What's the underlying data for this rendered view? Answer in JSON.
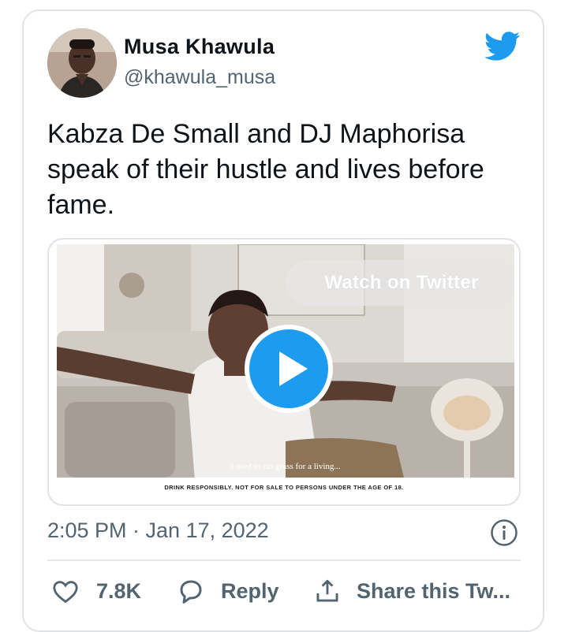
{
  "author": {
    "name": "Musa Khawula",
    "handle": "@khawula_musa",
    "avatar_icon": "profile-photo"
  },
  "brand_icon": "twitter-bird-icon",
  "brand_color": "#1d9bf0",
  "tweet": {
    "text": "Kabza De Small and DJ Maphorisa speak of their hustle and lives before fame."
  },
  "media": {
    "watch_label": "Watch on Twitter",
    "subtitle": "I used to cut grass for a living...",
    "disclaimer": "DRINK RESPONSIBLY. NOT FOR SALE TO PERSONS UNDER THE AGE OF 18.",
    "play_icon": "play-icon"
  },
  "meta": {
    "timestamp": "2:05 PM · Jan 17, 2022",
    "info_icon": "info-icon"
  },
  "actions": {
    "like_count": "7.8K",
    "reply_label": "Reply",
    "share_label": "Share this Tw..."
  }
}
